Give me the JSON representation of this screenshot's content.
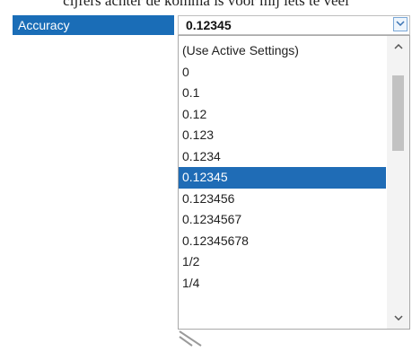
{
  "caption": {
    "text": "cijfers achter de komma is voor mij iets te veel"
  },
  "property": {
    "label": "Accuracy",
    "value": "0.12345"
  },
  "dropdown": {
    "button_icon": "chevron-down-icon",
    "items": [
      {
        "label": "(Use Active Settings)",
        "selected": false
      },
      {
        "label": "0",
        "selected": false
      },
      {
        "label": "0.1",
        "selected": false
      },
      {
        "label": "0.12",
        "selected": false
      },
      {
        "label": "0.123",
        "selected": false
      },
      {
        "label": "0.1234",
        "selected": false
      },
      {
        "label": "0.12345",
        "selected": true
      },
      {
        "label": "0.123456",
        "selected": false
      },
      {
        "label": "0.1234567",
        "selected": false
      },
      {
        "label": "0.12345678",
        "selected": false
      },
      {
        "label": "1/2",
        "selected": false
      },
      {
        "label": "1/4",
        "selected": false
      }
    ]
  },
  "colors": {
    "accent": "#1a6db7",
    "selection": "#1f6cb6",
    "scroll_thumb": "#c2c2c2"
  },
  "icons": {
    "scroll_up": "chevron-up-icon",
    "scroll_down": "chevron-down-icon",
    "resize": "resize-grip-icon"
  }
}
